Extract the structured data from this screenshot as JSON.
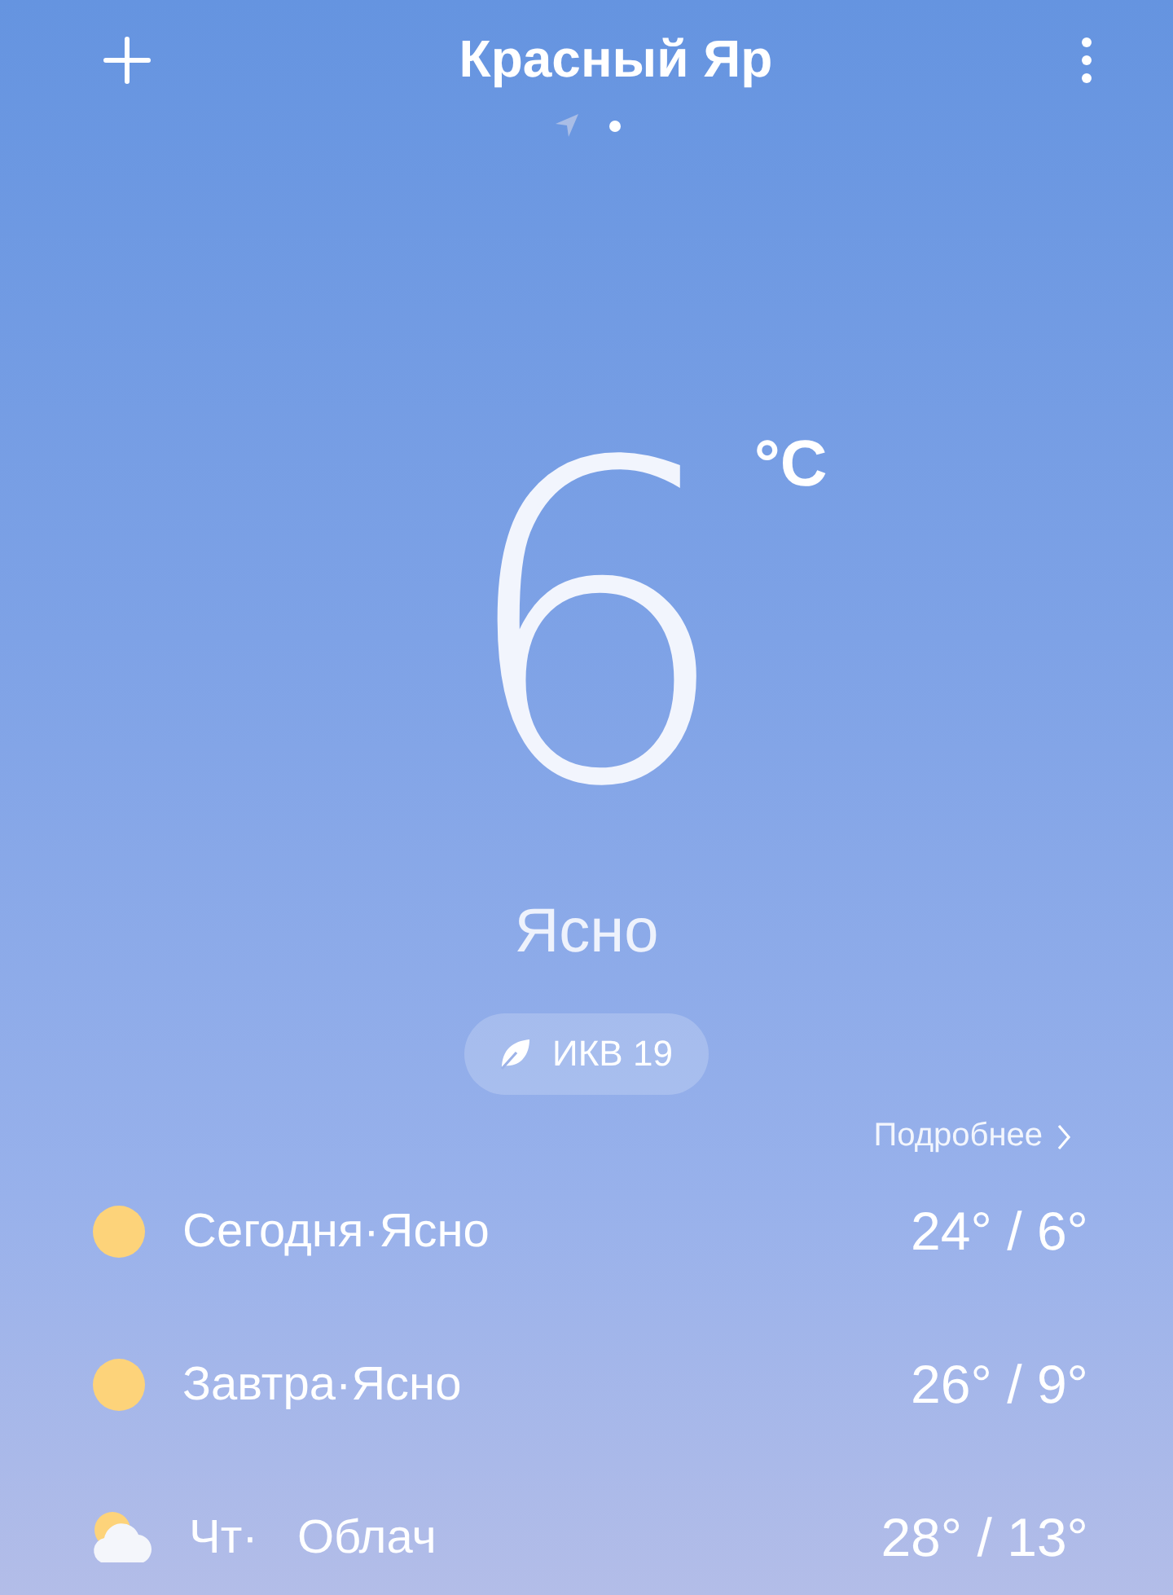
{
  "header": {
    "title": "Красный Яр"
  },
  "pages": [
    {
      "kind": "location",
      "selected": false
    },
    {
      "kind": "dot",
      "selected": true
    }
  ],
  "current": {
    "temperature": "6",
    "unit": "°C",
    "condition": "Ясно",
    "aqi": "ИКВ 19"
  },
  "more_link": "Подробнее",
  "forecast": [
    {
      "kind": "sun",
      "label": "Сегодня·Ясно",
      "temps": "24° / 6°"
    },
    {
      "kind": "sun",
      "label": "Завтра·Ясно",
      "temps": "26° / 9°"
    },
    {
      "kind": "cloudy",
      "label": "Чт·   Облач",
      "temps": "28° / 13°"
    }
  ]
}
